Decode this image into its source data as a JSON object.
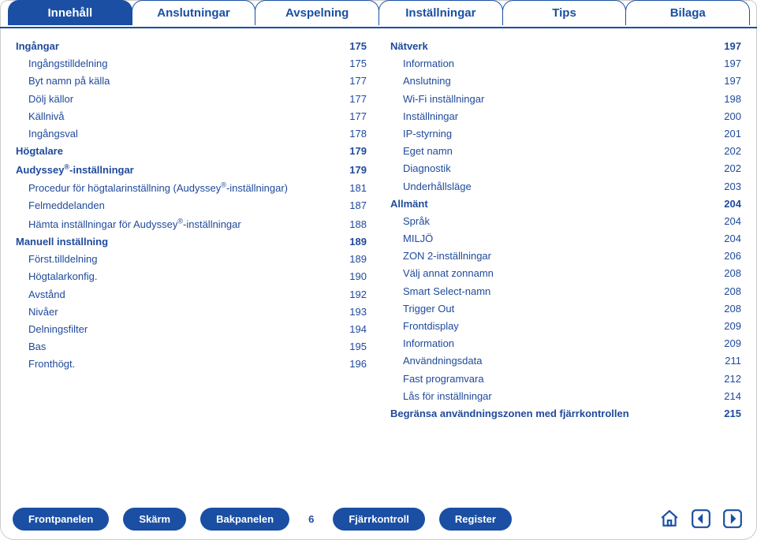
{
  "tabs": [
    {
      "label": "Innehåll",
      "active": true
    },
    {
      "label": "Anslutningar"
    },
    {
      "label": "Avspelning"
    },
    {
      "label": "Inställningar"
    },
    {
      "label": "Tips"
    },
    {
      "label": "Bilaga"
    }
  ],
  "left_column": [
    {
      "label": "Ingångar",
      "page": "175",
      "bold": true
    },
    {
      "label": "Ingångstilldelning",
      "page": "175",
      "indent": true
    },
    {
      "label": "Byt namn på källa",
      "page": "177",
      "indent": true
    },
    {
      "label": "Dölj källor",
      "page": "177",
      "indent": true
    },
    {
      "label": "Källnivå",
      "page": "177",
      "indent": true
    },
    {
      "label": "Ingångsval",
      "page": "178",
      "indent": true
    },
    {
      "label": "Högtalare",
      "page": "179",
      "bold": true
    },
    {
      "label": "Audyssey®-inställningar",
      "page": "179",
      "bold": true,
      "reg_after_word": true
    },
    {
      "label": "Procedur för högtalarinställning (Audyssey®-inställningar)",
      "page": "181",
      "indent": true,
      "reg_after_word2": true
    },
    {
      "label": "Felmeddelanden",
      "page": "187",
      "indent": true
    },
    {
      "label": "Hämta inställningar för Audyssey®-inställningar",
      "page": "188",
      "indent": true,
      "reg_after_word3": true
    },
    {
      "label": "Manuell inställning",
      "page": "189",
      "bold": true
    },
    {
      "label": "Först.tilldelning",
      "page": "189",
      "indent": true
    },
    {
      "label": "Högtalarkonfig.",
      "page": "190",
      "indent": true
    },
    {
      "label": "Avstånd",
      "page": "192",
      "indent": true
    },
    {
      "label": "Nivåer",
      "page": "193",
      "indent": true
    },
    {
      "label": "Delningsfilter",
      "page": "194",
      "indent": true
    },
    {
      "label": "Bas",
      "page": "195",
      "indent": true
    },
    {
      "label": "Fronthögt.",
      "page": "196",
      "indent": true
    }
  ],
  "right_column": [
    {
      "label": "Nätverk",
      "page": "197",
      "bold": true
    },
    {
      "label": "Information",
      "page": "197",
      "indent": true
    },
    {
      "label": "Anslutning",
      "page": "197",
      "indent": true
    },
    {
      "label": "Wi-Fi inställningar",
      "page": "198",
      "indent": true
    },
    {
      "label": "Inställningar",
      "page": "200",
      "indent": true
    },
    {
      "label": "IP-styrning",
      "page": "201",
      "indent": true
    },
    {
      "label": "Eget namn",
      "page": "202",
      "indent": true
    },
    {
      "label": "Diagnostik",
      "page": "202",
      "indent": true
    },
    {
      "label": "Underhållsläge",
      "page": "203",
      "indent": true
    },
    {
      "label": "Allmänt",
      "page": "204",
      "bold": true
    },
    {
      "label": "Språk",
      "page": "204",
      "indent": true
    },
    {
      "label": "MILJÖ",
      "page": "204",
      "indent": true
    },
    {
      "label": "ZON 2-inställningar",
      "page": "206",
      "indent": true
    },
    {
      "label": "Välj annat zonnamn",
      "page": "208",
      "indent": true
    },
    {
      "label": "Smart Select-namn",
      "page": "208",
      "indent": true
    },
    {
      "label": "Trigger Out",
      "page": "208",
      "indent": true
    },
    {
      "label": "Frontdisplay",
      "page": "209",
      "indent": true
    },
    {
      "label": "Information",
      "page": "209",
      "indent": true
    },
    {
      "label": "Användningsdata",
      "page": "211",
      "indent": true
    },
    {
      "label": "Fast programvara",
      "page": "212",
      "indent": true
    },
    {
      "label": "Lås för inställningar",
      "page": "214",
      "indent": true
    },
    {
      "label": "Begränsa användningszonen med fjärrkontrollen",
      "page": "215",
      "bold": true
    }
  ],
  "footer": {
    "buttons": [
      "Frontpanelen",
      "Skärm",
      "Bakpanelen"
    ],
    "page_number": "6",
    "buttons2": [
      "Fjärrkontroll",
      "Register"
    ]
  }
}
